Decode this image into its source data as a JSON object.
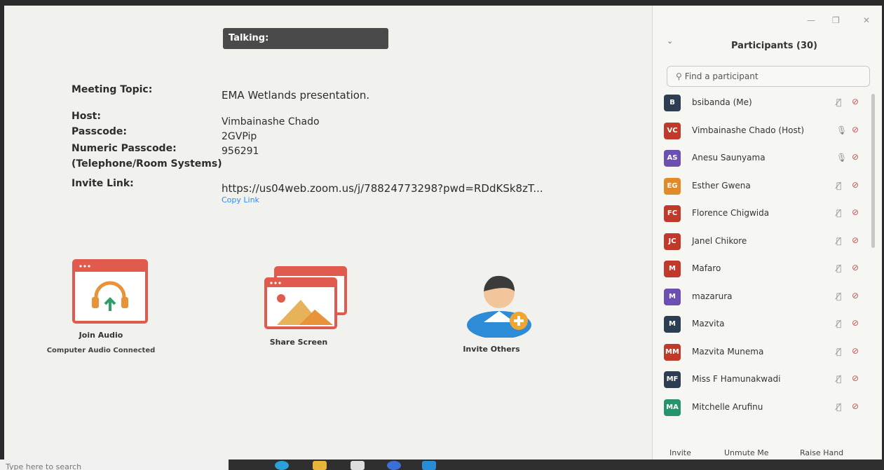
{
  "meeting": {
    "talking_label": "Talking:",
    "topic_label": "Meeting Topic:",
    "topic_value": "EMA Wetlands presentation.",
    "host_label": "Host:",
    "host_value": "Vimbainashe Chado",
    "passcode_label": "Passcode:",
    "passcode_value": "2GVPip",
    "numeric_passcode_label_1": "Numeric Passcode:",
    "numeric_passcode_label_2": "(Telephone/Room Systems)",
    "numeric_passcode_value": "956291",
    "invite_link_label": "Invite Link:",
    "invite_link_value": "https://us04web.zoom.us/j/78824773298?pwd=RDdKSk8zT...",
    "copy_link_label": "Copy Link"
  },
  "actions": {
    "join_audio": "Join Audio",
    "join_audio_status": "Computer Audio Connected",
    "share_screen": "Share Screen",
    "invite_others": "Invite Others"
  },
  "panel": {
    "title": "Participants (30)",
    "search_placeholder": "Find a participant",
    "invite": "Invite",
    "unmute": "Unmute Me",
    "raise_hand": "Raise Hand",
    "participants": [
      {
        "initials": "B",
        "name": "bsibanda (Me)",
        "color": "#2e3e52",
        "mic": "muted"
      },
      {
        "initials": "VC",
        "name": "Vimbainashe Chado (Host)",
        "color": "#c0392b",
        "mic": "on"
      },
      {
        "initials": "AS",
        "name": "Anesu Saunyama",
        "color": "#6c4fb3",
        "mic": "on"
      },
      {
        "initials": "EG",
        "name": "Esther Gwena",
        "color": "#e08a2c",
        "mic": "muted"
      },
      {
        "initials": "FC",
        "name": "Florence Chigwida",
        "color": "#c0392b",
        "mic": "muted"
      },
      {
        "initials": "JC",
        "name": "Janel Chikore",
        "color": "#c0392b",
        "mic": "muted"
      },
      {
        "initials": "M",
        "name": "Mafaro",
        "color": "#c0392b",
        "mic": "muted"
      },
      {
        "initials": "M",
        "name": "mazarura",
        "color": "#6c4fb3",
        "mic": "muted"
      },
      {
        "initials": "M",
        "name": "Mazvita",
        "color": "#2e3e52",
        "mic": "muted"
      },
      {
        "initials": "MM",
        "name": "Mazvita Munema",
        "color": "#c0392b",
        "mic": "muted"
      },
      {
        "initials": "MF",
        "name": "Miss F Hamunakwadi",
        "color": "#2e3e52",
        "mic": "muted"
      },
      {
        "initials": "MA",
        "name": "Mitchelle Arufinu",
        "color": "#27946e",
        "mic": "muted"
      }
    ]
  },
  "taskbar": {
    "search_placeholder": "Type here to search"
  }
}
